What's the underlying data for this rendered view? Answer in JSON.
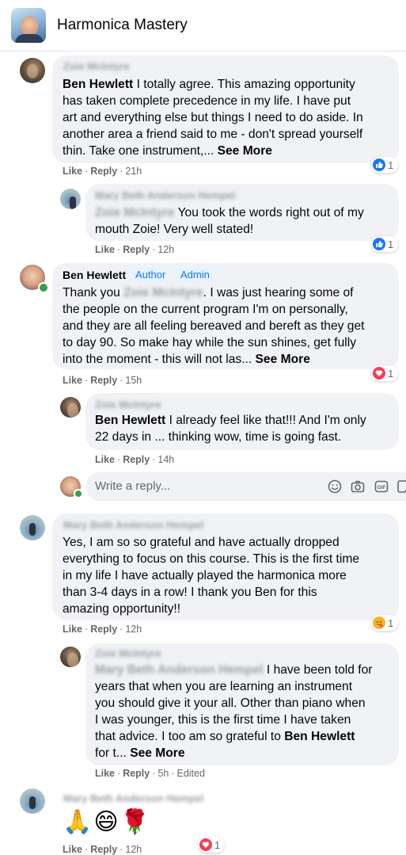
{
  "header": {
    "title": "Harmonica Mastery"
  },
  "comments": [
    {
      "author": "Zoie McIntyre",
      "mention": "Ben Hewlett",
      "lines": [
        " I totally agree. This amazing opportunity",
        "has taken complete precedence in my life. I have put",
        "art and everything else but things I need to do aside. In",
        "another area a friend said to me - don't spread yourself",
        "thin. Take one instrument,... "
      ],
      "see_more": "See More",
      "like": "Like",
      "reply": "Reply",
      "time": "21h",
      "reaction_count": "1"
    },
    {
      "author": "Mary Beth Anderson Hempel",
      "mention": "Zoie McIntyre",
      "lines": [
        " You took the words right out of my",
        "mouth Zoie! Very well stated!"
      ],
      "like": "Like",
      "reply": "Reply",
      "time": "12h",
      "reaction_count": "1"
    },
    {
      "author": "Ben Hewlett",
      "badge_author": "Author",
      "badge_admin": "Admin",
      "prefix": "Thank you ",
      "mention": "Zoie McIntyre",
      "lines": [
        ". I was just hearing some of",
        "the people on the current program I'm on personally,",
        "and they are all feeling bereaved and bereft as they get",
        "to day 90. So make hay while the sun shines, get fully",
        "into the moment - this will not las... "
      ],
      "see_more": "See More",
      "like": "Like",
      "reply": "Reply",
      "time": "15h",
      "reaction_count": "1"
    },
    {
      "author": "Zoie McIntyre",
      "mention": "Ben Hewlett",
      "lines": [
        " I already feel like that!!! And I'm only",
        "22 days in ... thinking wow, time is going fast."
      ],
      "like": "Like",
      "reply": "Reply",
      "time": "14h"
    },
    {
      "author": "Mary Beth Anderson Hempel",
      "lines": [
        "Yes, I am so so grateful and have actually dropped",
        "everything to focus on this course. This is the first time",
        "in my life I have actually played the harmonica more",
        "than 3-4 days in a row! I thank you Ben for this",
        "amazing opportunity!!"
      ],
      "like": "Like",
      "reply": "Reply",
      "time": "12h",
      "reaction_count": "1"
    },
    {
      "author": "Zoie McIntyre",
      "mention": "Mary Beth Anderson Hempel",
      "lines": [
        " I have been told for",
        "years that when you are learning an instrument",
        "you should give it your all. Other than piano when",
        "I was younger, this is the first time I have taken",
        "that advice. I too am so grateful to "
      ],
      "mention2": "Ben Hewlett",
      "last_line": "for t... ",
      "see_more": "See More",
      "like": "Like",
      "reply": "Reply",
      "time": "5h",
      "edited": "Edited"
    },
    {
      "author": "Mary Beth Anderson Hempel",
      "emojis": "🙏😄🌹",
      "like": "Like",
      "reply": "Reply",
      "time": "12h",
      "reaction_count": "1"
    }
  ],
  "reply_box": {
    "placeholder": "Write a reply..."
  }
}
